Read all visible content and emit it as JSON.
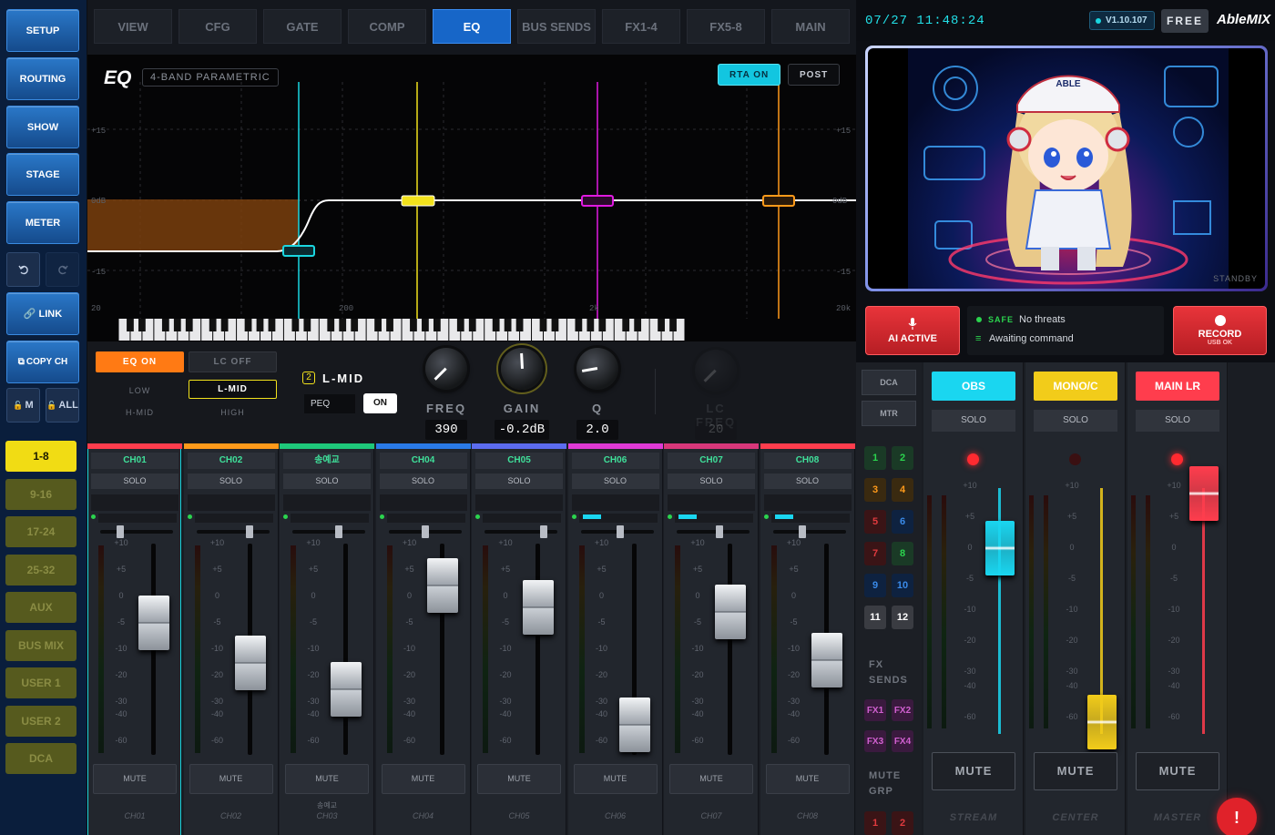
{
  "left_nav": {
    "main_buttons": [
      "SETUP",
      "ROUTING",
      "SHOW",
      "STAGE",
      "METER"
    ],
    "undo_icon": "undo-icon",
    "redo_icon": "redo-icon",
    "link_label": "LINK",
    "copy_label": "COPY CH",
    "lock_m_label": "M",
    "lock_all_label": "ALL",
    "banks": [
      "1-8",
      "9-16",
      "17-24",
      "25-32",
      "AUX",
      "BUS MIX",
      "USER 1",
      "USER 2",
      "DCA"
    ],
    "active_bank": "1-8"
  },
  "tabs": [
    "VIEW",
    "CFG",
    "GATE",
    "COMP",
    "EQ",
    "BUS SENDS",
    "FX1-4",
    "FX5-8",
    "MAIN"
  ],
  "active_tab": "EQ",
  "eq": {
    "title": "EQ",
    "subtitle": "4-BAND PARAMETRIC",
    "rta_label": "RTA ON",
    "post_label": "POST",
    "db_labels": {
      "top": "+15",
      "mid": "0dB",
      "bottom": "-15"
    },
    "freq_labels": [
      "20",
      "200",
      "2k",
      "20k"
    ],
    "band_colors": {
      "low": "#1ad6e0",
      "lmid": "#f2e21c",
      "hmid": "#e01ae0",
      "high": "#ff9a1a"
    }
  },
  "eq_controls": {
    "eq_on_label": "EQ ON",
    "lc_off_label": "LC OFF",
    "bands": {
      "low": "LOW",
      "lmid": "L-MID",
      "hmid": "H-MID",
      "high": "HIGH"
    },
    "selected_band_num": "2",
    "selected_band_name": "L-MID",
    "type_label": "PEQ",
    "on_label": "ON",
    "knobs": [
      {
        "label": "FREQ",
        "value": "390"
      },
      {
        "label": "GAIN",
        "value": "-0.2dB"
      },
      {
        "label": "Q",
        "value": "2.0"
      },
      {
        "label": "LC FREQ",
        "value": "20"
      }
    ]
  },
  "channels": [
    {
      "name": "CH01",
      "color": "#ff3d4d",
      "solo": "SOLO",
      "mute": "MUTE",
      "scribble": "CH01",
      "fader_db": -5,
      "pan": 0.25,
      "selected": true
    },
    {
      "name": "CH02",
      "color": "#ff9a1a",
      "solo": "SOLO",
      "mute": "MUTE",
      "scribble": "CH02",
      "fader_db": -15,
      "pan": 0.75
    },
    {
      "name": "송예교",
      "color": "#1ec87a",
      "solo": "SOLO",
      "mute": "MUTE",
      "scribble": "CH03",
      "sub": "송예교",
      "fader_db": -25,
      "pan": 0.65
    },
    {
      "name": "CH04",
      "color": "#2a7ae8",
      "solo": "SOLO",
      "mute": "MUTE",
      "scribble": "CH04",
      "fader_db": 2,
      "pan": 0.5
    },
    {
      "name": "CH05",
      "color": "#5c6cf0",
      "solo": "SOLO",
      "mute": "MUTE",
      "scribble": "CH05",
      "fader_db": -2,
      "pan": 0.85
    },
    {
      "name": "CH06",
      "color": "#e03ad6",
      "solo": "SOLO",
      "mute": "MUTE",
      "scribble": "CH06",
      "fader_db": -45,
      "pan": 0.55
    },
    {
      "name": "CH07",
      "color": "#d8377a",
      "solo": "SOLO",
      "mute": "MUTE",
      "scribble": "CH07",
      "fader_db": -3,
      "pan": 0.6
    },
    {
      "name": "CH08",
      "color": "#ff3d4d",
      "solo": "SOLO",
      "mute": "MUTE",
      "scribble": "CH08",
      "fader_db": -14,
      "pan": 0.4
    }
  ],
  "fader_scale": [
    "+10",
    "+5",
    "0",
    "-5",
    "-10",
    "-20",
    "-30",
    "-40",
    "-60"
  ],
  "header": {
    "datetime": "07/27  11:48:24",
    "version": "V1.10.107",
    "plan": "FREE",
    "brand": "AbleMIX"
  },
  "preview": {
    "status": "STANDBY",
    "cap_text": "ABLE"
  },
  "ai": {
    "ai_label": "AI ACTIVE",
    "safe_label": "SAFE",
    "threat_text": "No threats",
    "command_text": "Awaiting command",
    "record_label": "RECORD",
    "record_sub": "USB OK"
  },
  "right_mixer": {
    "dca_label": "DCA",
    "mtr_label": "MTR",
    "dca_buttons": [
      "1",
      "2",
      "3",
      "4",
      "5",
      "6",
      "7",
      "8",
      "9",
      "10",
      "11",
      "12"
    ],
    "fx_title": "FX SENDS",
    "fx_buttons": [
      "FX1",
      "FX2",
      "FX3",
      "FX4"
    ],
    "mute_grp_title": "MUTE GRP",
    "mute_grp_buttons": [
      "1",
      "2"
    ],
    "buses": [
      {
        "name": "OBS",
        "color": "#1ad6f0",
        "text": "#ffffff",
        "solo": "SOLO",
        "mute": "MUTE",
        "footer": "STREAM",
        "led": "on",
        "fader_db": -0.2
      },
      {
        "name": "MONO/C",
        "color": "#f2cc1a",
        "text": "#ffffff",
        "solo": "SOLO",
        "mute": "MUTE",
        "footer": "CENTER",
        "led": "off",
        "fader_db": -63
      },
      {
        "name": "MAIN LR",
        "color": "#ff3d4d",
        "text": "#ffffff",
        "solo": "SOLO",
        "mute": "MUTE",
        "footer": "MASTER",
        "led": "on",
        "fader_db": 9
      }
    ],
    "bus_scale": [
      "+10",
      "+5",
      "0",
      "-5",
      "-10",
      "-20",
      "-30",
      "-40",
      "-60"
    ]
  }
}
